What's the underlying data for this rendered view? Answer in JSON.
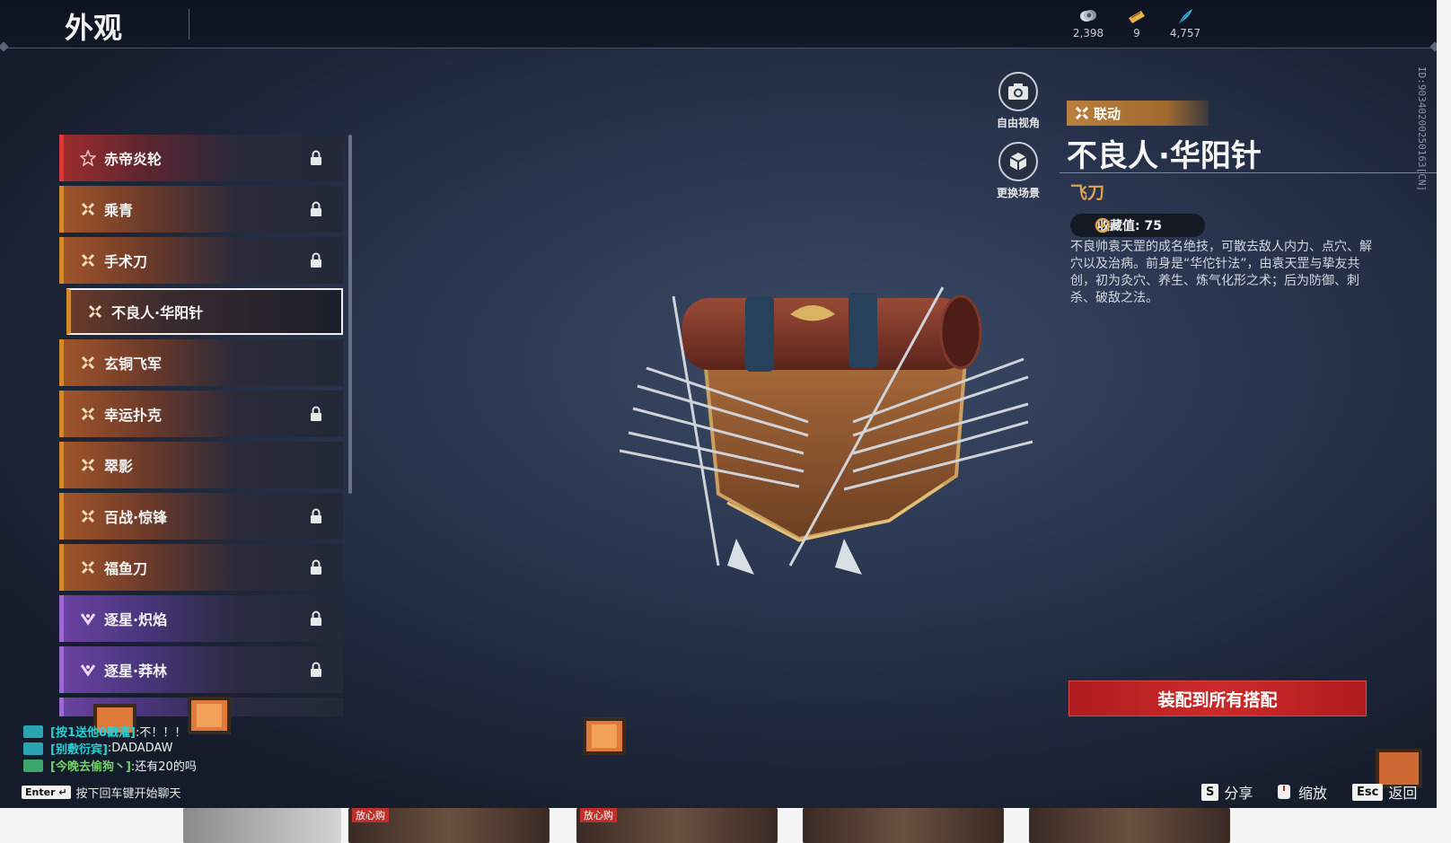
{
  "header": {
    "title": "外观",
    "currencies": [
      {
        "icon": "coin-icon",
        "value": "2,398"
      },
      {
        "icon": "ticket-icon",
        "value": "9"
      },
      {
        "icon": "feather-icon",
        "value": "4,757"
      }
    ]
  },
  "item_list": [
    {
      "name": "赤帝炎轮",
      "rarity": "red",
      "locked": true
    },
    {
      "name": "乘青",
      "rarity": "orange",
      "locked": true
    },
    {
      "name": "手术刀",
      "rarity": "orange",
      "locked": true
    },
    {
      "name": "不良人·华阳针",
      "rarity": "orange",
      "locked": false,
      "selected": true
    },
    {
      "name": "玄铜飞军",
      "rarity": "orange",
      "locked": false
    },
    {
      "name": "幸运扑克",
      "rarity": "orange",
      "locked": true
    },
    {
      "name": "翠影",
      "rarity": "orange",
      "locked": false
    },
    {
      "name": "百战·惊锋",
      "rarity": "orange",
      "locked": true
    },
    {
      "name": "福鱼刀",
      "rarity": "orange",
      "locked": true
    },
    {
      "name": "逐星·炽焰",
      "rarity": "purple",
      "locked": true
    },
    {
      "name": "逐星·莽林",
      "rarity": "purple",
      "locked": true
    }
  ],
  "view_buttons": {
    "free_view": "自由视角",
    "change_scene": "更换场景"
  },
  "detail": {
    "tag": "联动",
    "title": "不良人·华阳针",
    "type": "飞刀",
    "collect_label": "收藏值: 75",
    "description": "不良帅袁天罡的成名绝技，可散去敌人内力、点穴、解穴以及治病。前身是“华佗针法”，由袁天罡与挚友共创，初为灸穴、养生、炼气化形之术；后为防御、刺杀、破敌之法。",
    "equip_button": "装配到所有搭配",
    "side_id": "ID:9034020025016​3[CN]"
  },
  "chat": {
    "lines": [
      {
        "channel": "[按1送他0戳灌]",
        "message": ":不！！！",
        "color": "cyan"
      },
      {
        "channel": "[别敷衍宾]",
        "message": ":DADADAW",
        "color": "cyan"
      },
      {
        "channel": "[今晚去偷狗丶]",
        "message": ":还有20的吗",
        "color": "green"
      }
    ],
    "hint_key": "Enter ↵",
    "hint_text": "按下回车键开始聊天"
  },
  "bottom_hints": {
    "share_key": "S",
    "share_label": "分享",
    "zoom_label": "缩放",
    "back_key": "Esc",
    "back_label": "返回"
  },
  "taskbar": {
    "badge": "放心购"
  },
  "colors": {
    "accent_orange": "#d4892e",
    "accent_red": "#d83b38",
    "accent_purple": "#9b6ad6",
    "equip_red": "#c0262a",
    "type_gold": "#e0a44e"
  }
}
